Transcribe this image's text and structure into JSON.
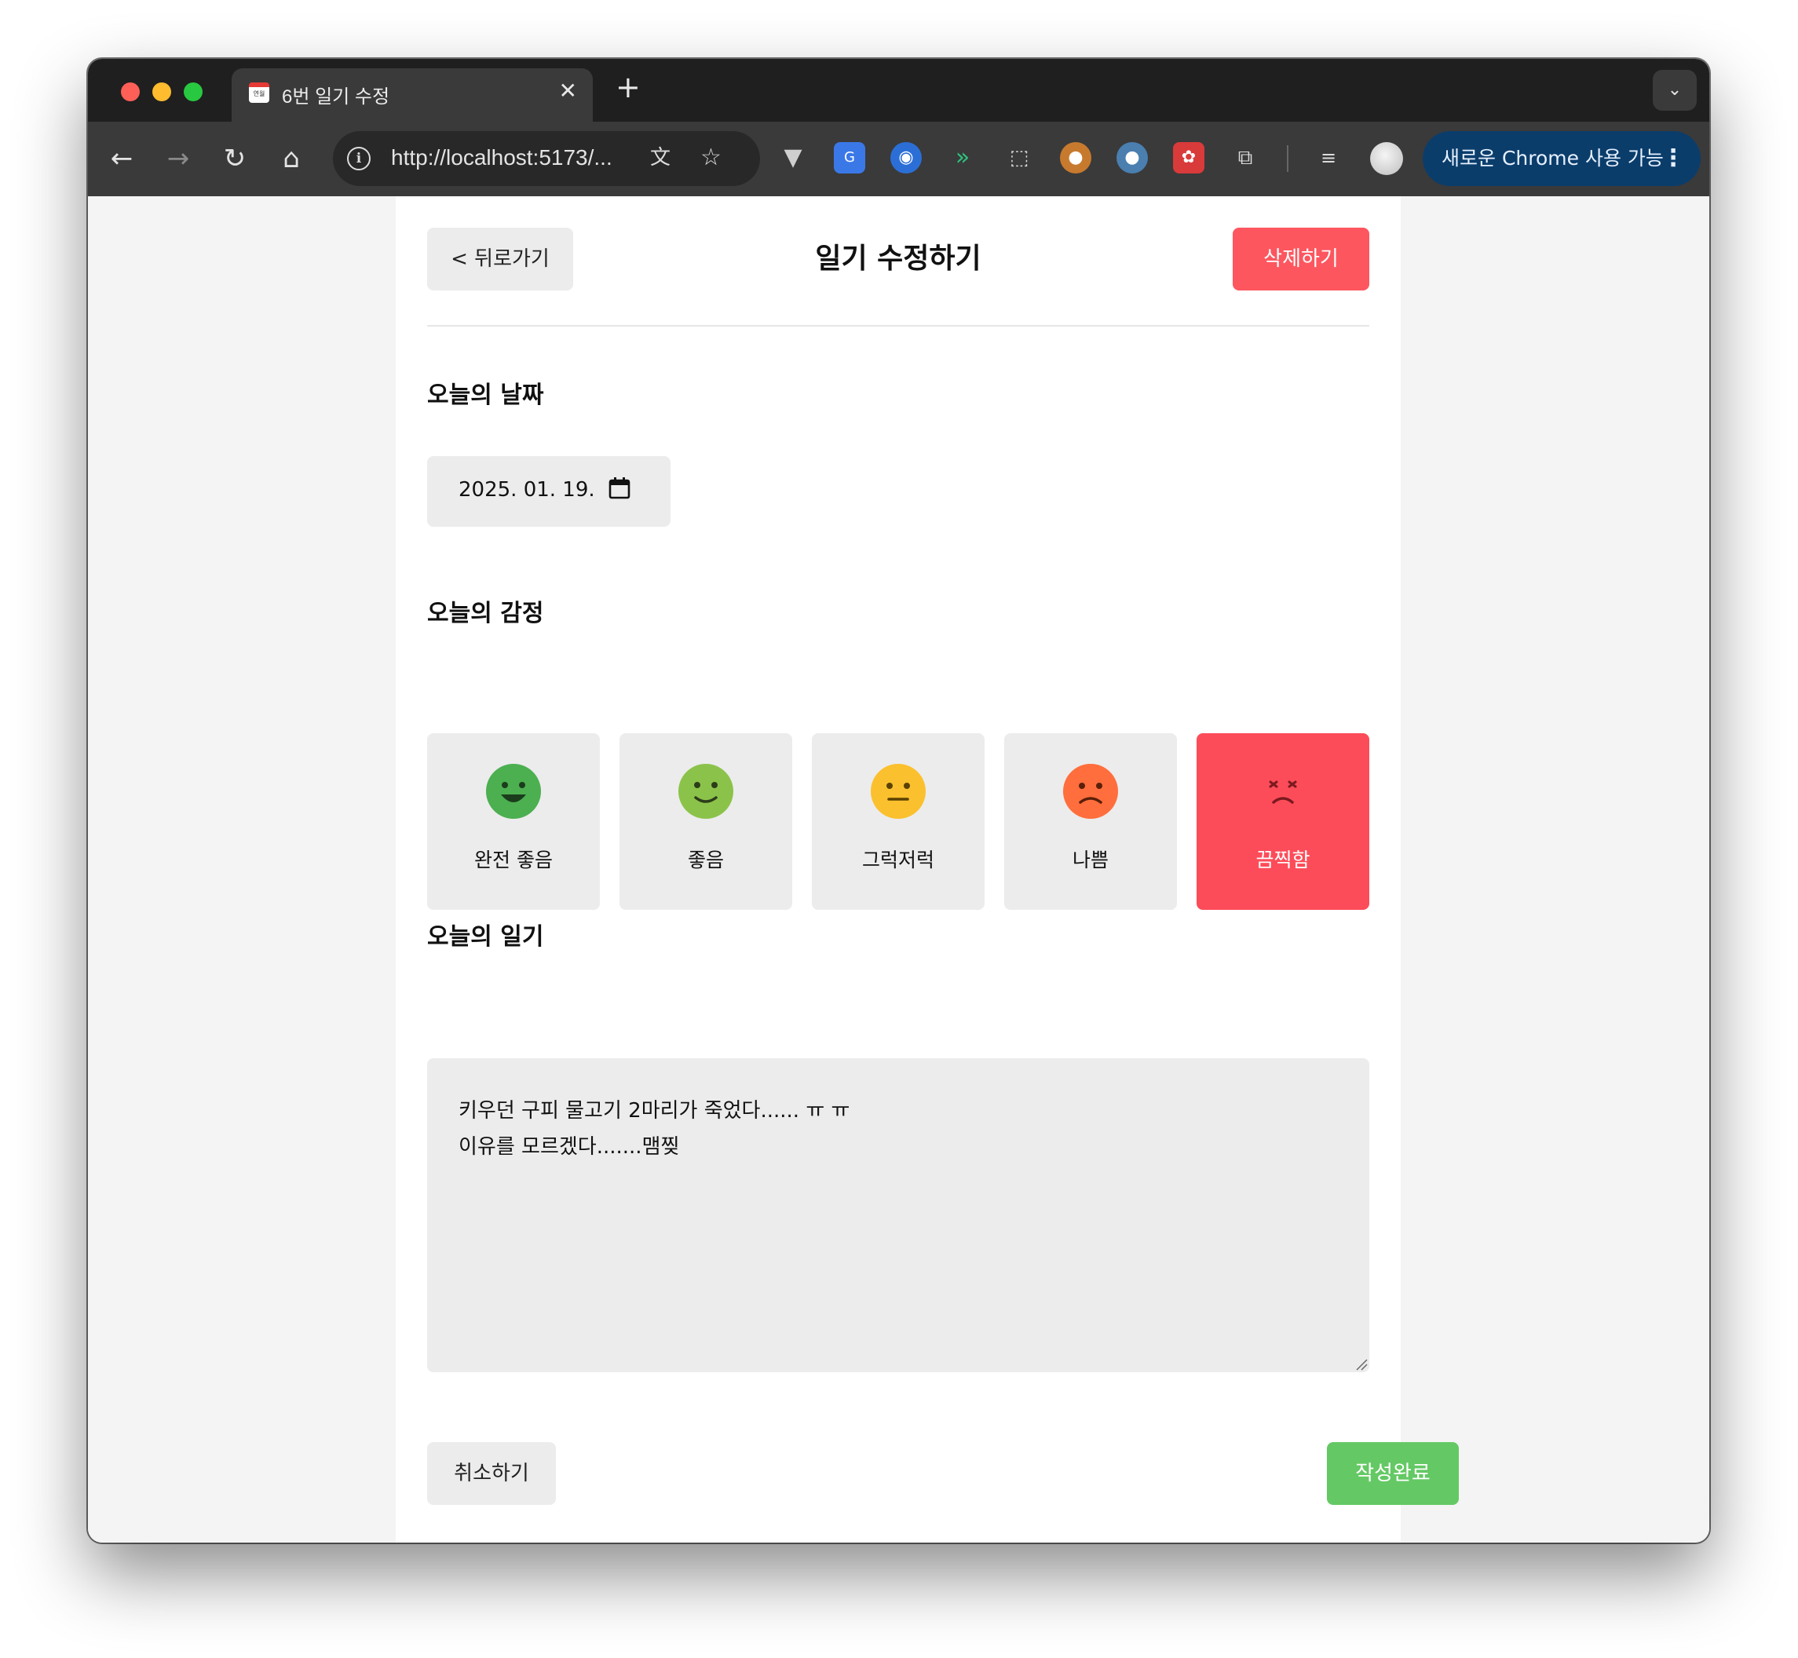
{
  "browser": {
    "tab_title": "6번 일기 수정",
    "tab_favicon_text": "연월",
    "url": "http://localhost:5173/...",
    "update_button": "새로운 Chrome 사용 가능"
  },
  "header": {
    "back_button": "< 뒤로가기",
    "title": "일기 수정하기",
    "delete_button": "삭제하기"
  },
  "date_section": {
    "title": "오늘의 날짜",
    "value": "2025. 01. 19."
  },
  "emotion_section": {
    "title": "오늘의 감정",
    "selected_index": 4,
    "items": [
      {
        "label": "완전 좋음",
        "color": "#4caf50",
        "icon": "very-happy-face-icon"
      },
      {
        "label": "좋음",
        "color": "#8bc34a",
        "icon": "happy-face-icon"
      },
      {
        "label": "그럭저럭",
        "color": "#fbc02d",
        "icon": "neutral-face-icon"
      },
      {
        "label": "나쁨",
        "color": "#ff6e3c",
        "icon": "sad-face-icon"
      },
      {
        "label": "끔찍함",
        "color": "#fd4c59",
        "icon": "terrible-face-icon"
      }
    ]
  },
  "diary_section": {
    "title": "오늘의 일기",
    "content": "키우던 구피 물고기 2마리가 죽었다...... ㅠ ㅠ\n이유를 모르겠다.......맴찢"
  },
  "footer": {
    "cancel_button": "취소하기",
    "submit_button": "작성완료"
  },
  "colors": {
    "delete_accent": "#fd565f",
    "submit_accent": "#64c964",
    "selected_emotion": "#fd4c59"
  }
}
